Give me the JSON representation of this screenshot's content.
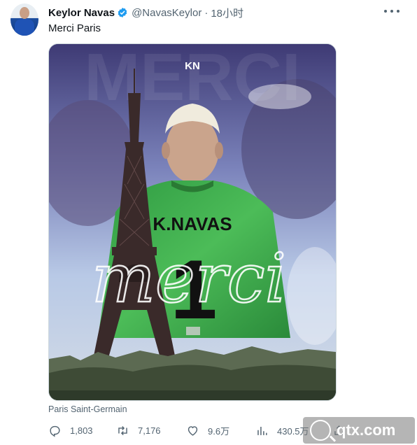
{
  "author": {
    "name": "Keylor Navas",
    "handle": "@NavasKeylor",
    "separator": "·",
    "time": "18小时"
  },
  "tweet": {
    "text": "Merci Paris"
  },
  "media": {
    "logo_text": "KN",
    "jersey_name": "K.NAVAS",
    "jersey_number": "1",
    "script_text": "merci",
    "bg_word": "MERCI"
  },
  "source": "Paris Saint-Germain",
  "actions": {
    "replies": "1,803",
    "retweets": "7,176",
    "likes": "9.6万",
    "views": "430.5万"
  },
  "watermark": "qtx.com",
  "colors": {
    "verified": "#1d9bf0",
    "text_secondary": "#536471",
    "jersey_green": "#3aa84a"
  },
  "icons": [
    "verified-badge-icon",
    "more-icon",
    "reply-icon",
    "retweet-icon",
    "like-icon",
    "views-icon",
    "share-icon"
  ]
}
